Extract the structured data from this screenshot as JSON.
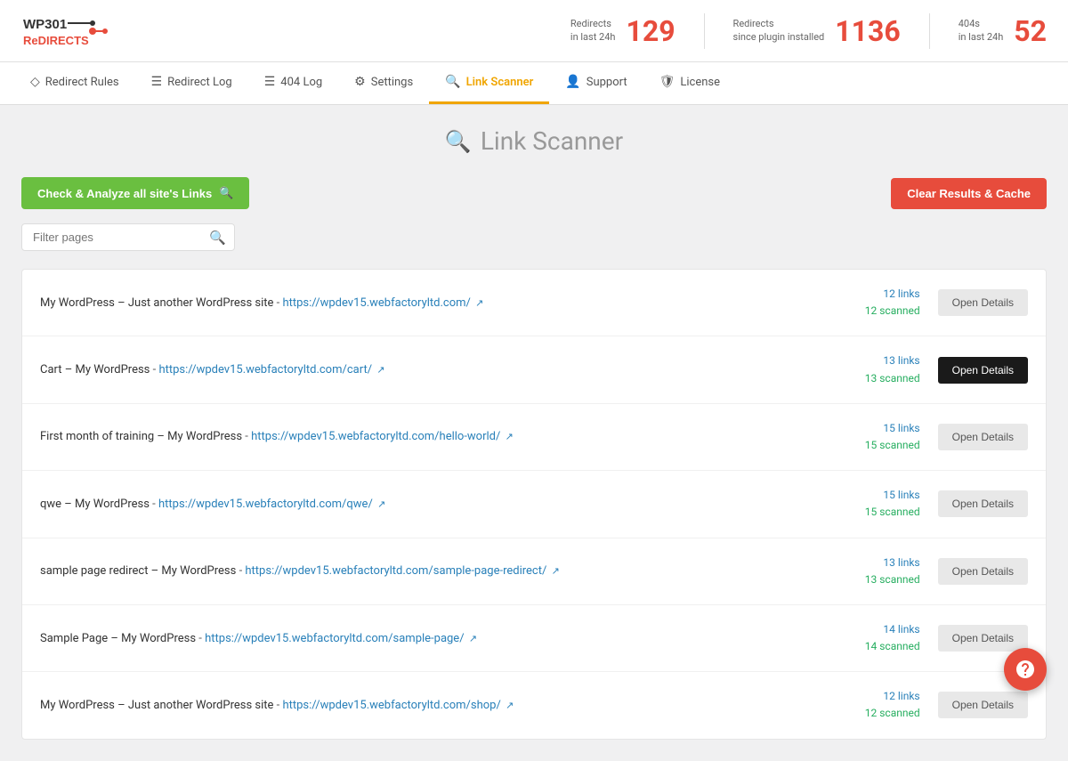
{
  "header": {
    "logo_alt": "WP301 Redirects",
    "stats": [
      {
        "label_line1": "Redirects",
        "label_line2": "in last 24h",
        "value": "129"
      },
      {
        "label_line1": "Redirects",
        "label_line2": "since plugin installed",
        "value": "1136"
      },
      {
        "label_line1": "404s",
        "label_line2": "in last 24h",
        "value": "52"
      }
    ]
  },
  "nav": {
    "tabs": [
      {
        "id": "redirect-rules",
        "icon": "◇",
        "label": "Redirect Rules",
        "active": false
      },
      {
        "id": "redirect-log",
        "icon": "☰",
        "label": "Redirect Log",
        "active": false
      },
      {
        "id": "404-log",
        "icon": "☰",
        "label": "404 Log",
        "active": false
      },
      {
        "id": "settings",
        "icon": "⚙",
        "label": "Settings",
        "active": false
      },
      {
        "id": "link-scanner",
        "icon": "🔍",
        "label": "Link Scanner",
        "active": true
      },
      {
        "id": "support",
        "icon": "👤",
        "label": "Support",
        "active": false
      },
      {
        "id": "license",
        "icon": "🛡",
        "label": "License",
        "active": false
      }
    ]
  },
  "page": {
    "title": "Link Scanner",
    "title_icon": "🔍"
  },
  "toolbar": {
    "check_analyze_label": "Check & Analyze all site's Links",
    "clear_cache_label": "Clear Results & Cache"
  },
  "filter": {
    "placeholder": "Filter pages"
  },
  "pages": [
    {
      "title": "My WordPress – Just another WordPress site",
      "url": "https://wpdev15.webfactoryltd.com/",
      "links": "12 links",
      "scanned": "12 scanned",
      "button_label": "Open Details",
      "button_active": false
    },
    {
      "title": "Cart – My WordPress",
      "url": "https://wpdev15.webfactoryltd.com/cart/",
      "links": "13 links",
      "scanned": "13 scanned",
      "button_label": "Open Details",
      "button_active": true
    },
    {
      "title": "First month of training – My WordPress",
      "url": "https://wpdev15.webfactoryltd.com/hello-world/",
      "links": "15 links",
      "scanned": "15 scanned",
      "button_label": "Open Details",
      "button_active": false
    },
    {
      "title": "qwe – My WordPress",
      "url": "https://wpdev15.webfactoryltd.com/qwe/",
      "links": "15 links",
      "scanned": "15 scanned",
      "button_label": "Open Details",
      "button_active": false
    },
    {
      "title": "sample page redirect – My WordPress",
      "url": "https://wpdev15.webfactoryltd.com/sample-page-redirect/",
      "links": "13 links",
      "scanned": "13 scanned",
      "button_label": "Open Details",
      "button_active": false
    },
    {
      "title": "Sample Page – My WordPress",
      "url": "https://wpdev15.webfactoryltd.com/sample-page/",
      "links": "14 links",
      "scanned": "14 scanned",
      "button_label": "Open Details",
      "button_active": false
    },
    {
      "title": "My WordPress – Just another WordPress site",
      "url": "https://wpdev15.webfactoryltd.com/shop/",
      "links": "12 links",
      "scanned": "12 scanned",
      "button_label": "Open Details",
      "button_active": false
    }
  ],
  "colors": {
    "accent_green": "#6abf40",
    "accent_red": "#e74c3c",
    "accent_orange": "#f0a500",
    "link_blue": "#2980b9",
    "scanned_green": "#27ae60"
  }
}
